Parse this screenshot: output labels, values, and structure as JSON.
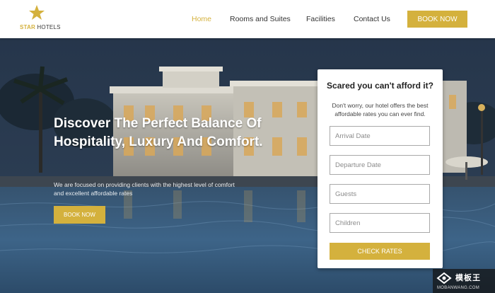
{
  "header": {
    "logo": {
      "star_word": "STAR",
      "hotels_word": "HOTELS",
      "icon": "star-icon"
    },
    "nav": [
      {
        "label": "Home",
        "active": true
      },
      {
        "label": "Rooms and Suites",
        "active": false
      },
      {
        "label": "Facilities",
        "active": false
      },
      {
        "label": "Contact Us",
        "active": false
      }
    ],
    "book_button": "BOOK NOW"
  },
  "hero": {
    "title": "Discover The Perfect Balance Of Hospitality, Luxury And Comfort.",
    "subtitle": "We are focused on providing clients with the highest level of comfort and excellent affordable rates",
    "book_button": "BOOK NOW"
  },
  "rates_form": {
    "title": "Scared you can't afford it?",
    "description": "Don't worry, our hotel offers the best affordable rates you can ever find.",
    "fields": {
      "arrival_placeholder": "Arrival Date",
      "departure_placeholder": "Departure Date",
      "guests_placeholder": "Guests",
      "children_placeholder": "Children"
    },
    "submit": "CHECK RATES"
  },
  "watermark": {
    "cn": "模板王",
    "en": "MOBANWANG.COM"
  },
  "colors": {
    "accent": "#d4b13d",
    "header_bg": "#ffffff",
    "nav_text": "#333333"
  }
}
